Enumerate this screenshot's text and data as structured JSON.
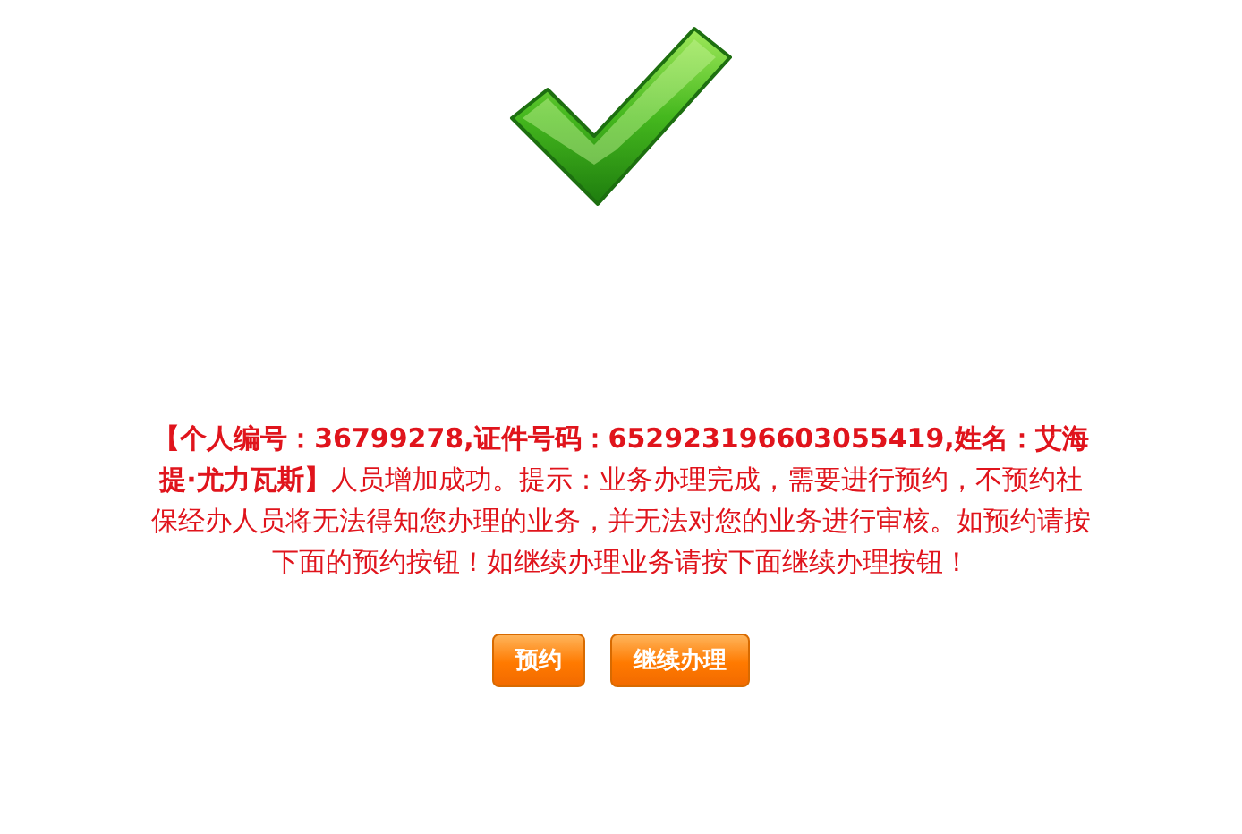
{
  "message": "**【个人编号：36799278,证件号码：652923196603055419,姓名：艾海提·尤力瓦斯】**人员增加成功。提示：业务办理完成，需要进行预约，不预约社保经办人员将无法得知您办理的业务，并无法对您的业务进行审核。如预约请按下面的预约按钮！如继续办理业务请按下面继续办理按钮！",
  "buttons": [
    {
      "label": "预约"
    },
    {
      "label": "继续办理"
    }
  ]
}
